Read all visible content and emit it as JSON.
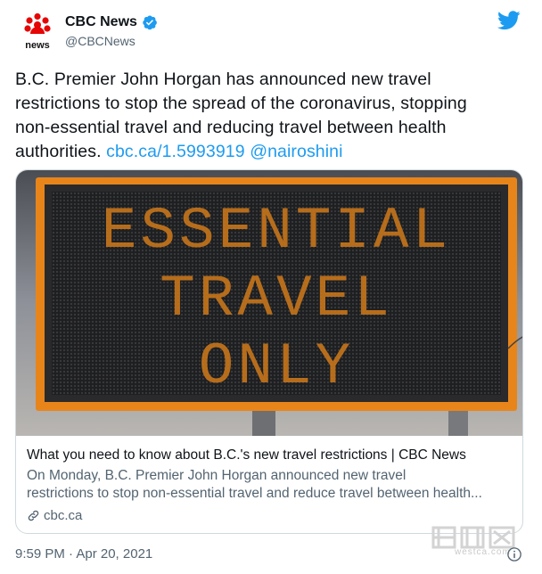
{
  "author": {
    "display_name": "CBC News",
    "handle": "@CBCNews",
    "logo_text": "news",
    "verified": true
  },
  "tweet": {
    "text_lines": [
      "B.C. Premier John Horgan has announced new travel",
      "restrictions to stop the spread of the coronavirus, stopping",
      "non-essential travel and reducing travel between health",
      "authorities. "
    ],
    "link": "cbc.ca/1.5993919",
    "mention": "@nairoshini"
  },
  "card": {
    "sign_lines": [
      "ESSENTIAL",
      "TRAVEL",
      "ONLY"
    ],
    "title": "What you need to know about B.C.'s new travel restrictions | CBC News",
    "description_lines": [
      "On Monday, B.C. Premier John Horgan announced new travel",
      "restrictions to stop non-essential travel and reduce travel between health..."
    ],
    "domain": "cbc.ca"
  },
  "footer": {
    "timestamp": "9:59 PM · Apr 20, 2021"
  },
  "watermark": {
    "text": "westca.com"
  },
  "colors": {
    "link": "#1d9bf0",
    "secondary_text": "#536471",
    "cbc_red": "#e60505",
    "sign_amber": "#e08a1e",
    "sign_frame": "#e8851a"
  }
}
